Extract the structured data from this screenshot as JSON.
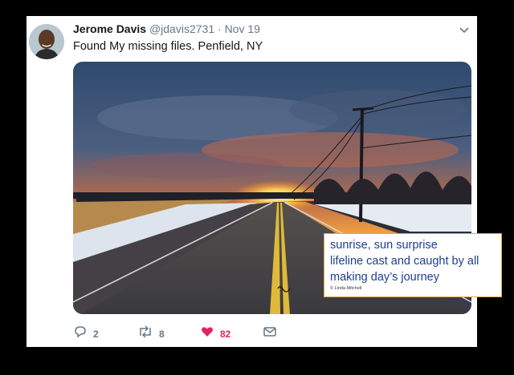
{
  "tweet": {
    "author_name": "Jerome Davis",
    "handle": "@jdavis2731",
    "separator": "·",
    "date": "Nov 19",
    "text": "Found My missing files. Penfield, NY"
  },
  "caption": {
    "lines": [
      "sunrise, sun surprise",
      "lifeline cast and caught by all",
      "making day’s journey"
    ],
    "credit": "© Linda Mitchell"
  },
  "actions": {
    "reply_count": "2",
    "retweet_count": "8",
    "like_count": "82"
  },
  "icons": {
    "reply": "reply-icon",
    "retweet": "retweet-icon",
    "like": "heart-icon",
    "message": "direct-message-icon",
    "menu": "chevron-down-icon"
  },
  "colors": {
    "like_active": "#e0245e",
    "caption_text": "#1b3f8f",
    "caption_border": "#e0a84a"
  }
}
